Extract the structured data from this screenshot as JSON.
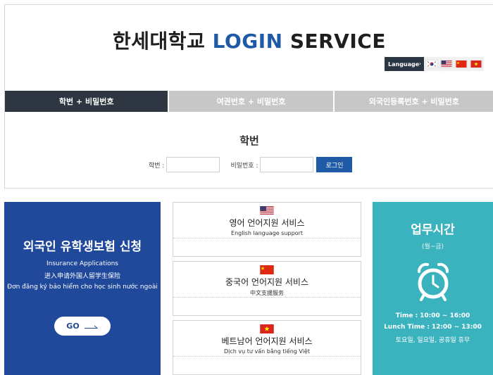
{
  "header": {
    "title_prefix": "한세대학교",
    "title_login": "LOGIN",
    "title_service": "SERVICE"
  },
  "language": {
    "label": "Language",
    "arrow": "›",
    "flags": [
      "flag-korea-icon",
      "flag-usa-icon",
      "flag-china-icon",
      "flag-vietnam-icon"
    ]
  },
  "tabs": [
    {
      "label": "학번 + 비밀번호",
      "active": true
    },
    {
      "label": "여권번호 + 비밀번호",
      "active": false
    },
    {
      "label": "외국인등록번호 + 비밀번호",
      "active": false
    }
  ],
  "form": {
    "heading": "학번",
    "id_label": "학번 :",
    "id_value": "",
    "pw_label": "비밀번호 :",
    "pw_value": "",
    "submit_label": "로그인"
  },
  "insurance": {
    "title": "외국인 유학생보험 신청",
    "en": "Insurance Applications",
    "zh": "进入申请外国人留学生保险",
    "vi": "Đơn đăng ký bảo hiểm cho học sinh nước ngoài",
    "go_label": "GO"
  },
  "support": [
    {
      "flag": "flag-usa-icon",
      "title": "영어 언어지원 서비스",
      "subtitle": "English language support"
    },
    {
      "flag": "flag-china-icon",
      "title": "중국어 언어지원 서비스",
      "subtitle": "中文支援服务"
    },
    {
      "flag": "flag-vietnam-icon",
      "title": "베트남어 언어지원 서비스",
      "subtitle": "Dịch vụ tư vấn bằng tiếng Việt"
    }
  ],
  "hours": {
    "title": "업무시간",
    "days": "(월~금)",
    "time_label": "Time :",
    "time_value": "10:00 ~ 16:00",
    "lunch_label": "Lunch Time :",
    "lunch_value": "12:00 ~ 13:00",
    "closed": "토요일, 일요일, 공휴일 휴무"
  },
  "colors": {
    "brand_blue": "#1f5aa6",
    "tab_active": "#2d3641",
    "tab_inactive": "#c7c7c7",
    "insurance_bg": "#20499b",
    "hours_bg": "#3bb3be"
  }
}
